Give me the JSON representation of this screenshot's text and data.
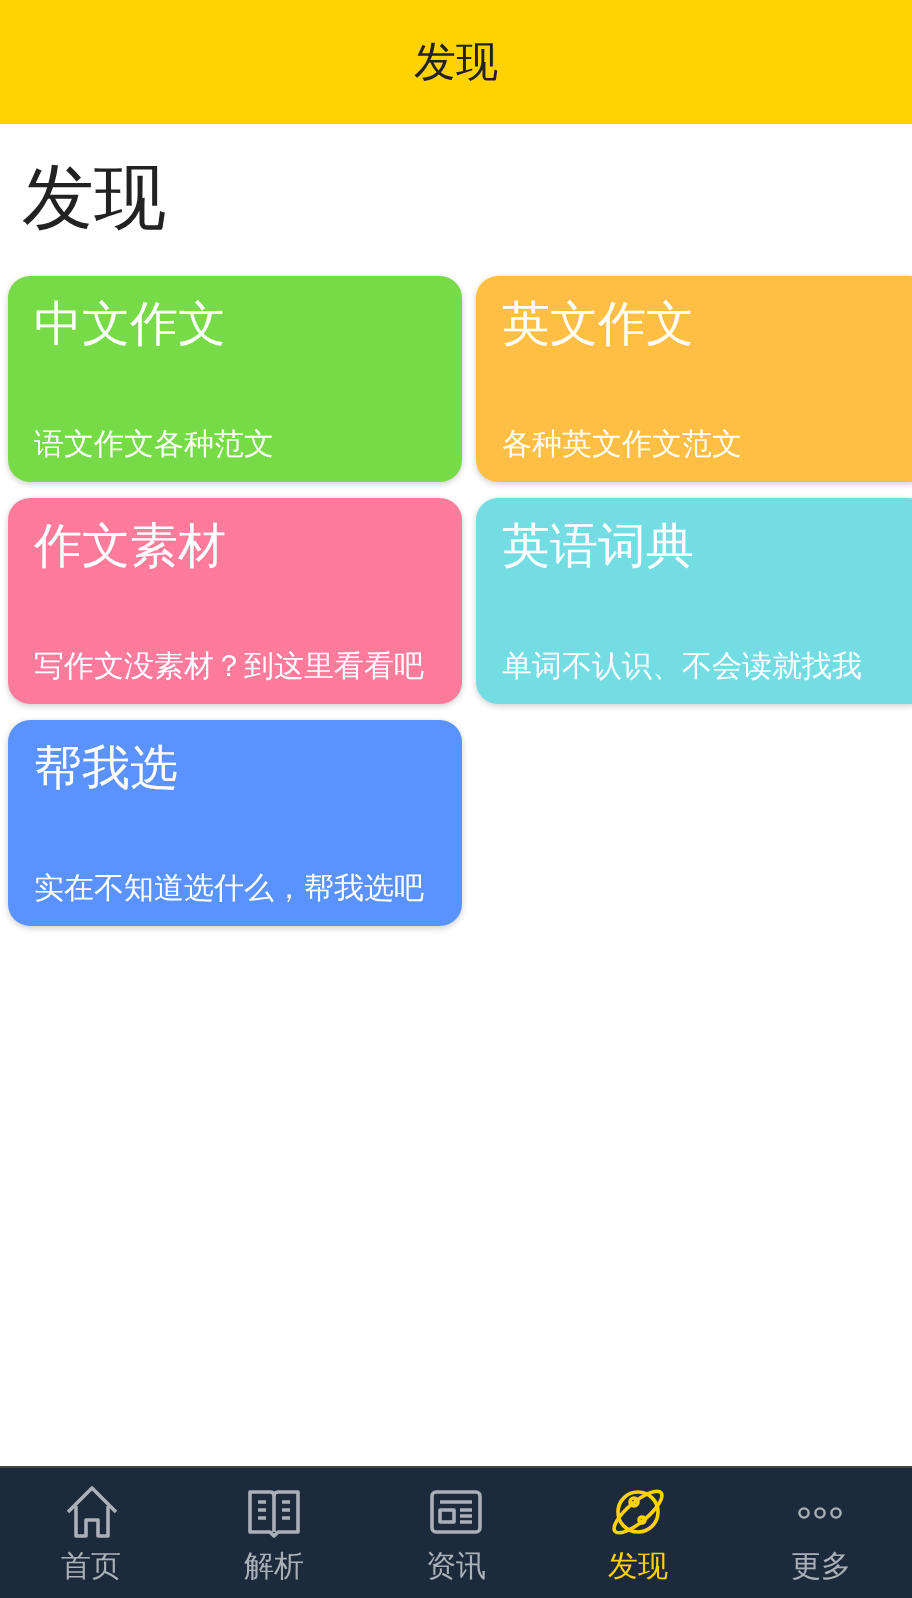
{
  "header": {
    "title": "发现"
  },
  "page_title": "发现",
  "cards": [
    {
      "title": "中文作文",
      "subtitle": "语文作文各种范文",
      "color": "#77db48"
    },
    {
      "title": "英文作文",
      "subtitle": "各种英文作文范文",
      "color": "#ffbe44"
    },
    {
      "title": "作文素材",
      "subtitle": "写作文没素材？到这里看看吧",
      "color": "#ff7b9c"
    },
    {
      "title": "英语词典",
      "subtitle": "单词不认识、不会读就找我",
      "color": "#74dde4"
    },
    {
      "title": "帮我选",
      "subtitle": "实在不知道选什么，帮我选吧",
      "color": "#5a93ff"
    }
  ],
  "tab_bar": [
    {
      "label": "首页",
      "selected": false
    },
    {
      "label": "解析",
      "selected": false
    },
    {
      "label": "资讯",
      "selected": false
    },
    {
      "label": "发现",
      "selected": true
    },
    {
      "label": "更多",
      "selected": false
    }
  ]
}
